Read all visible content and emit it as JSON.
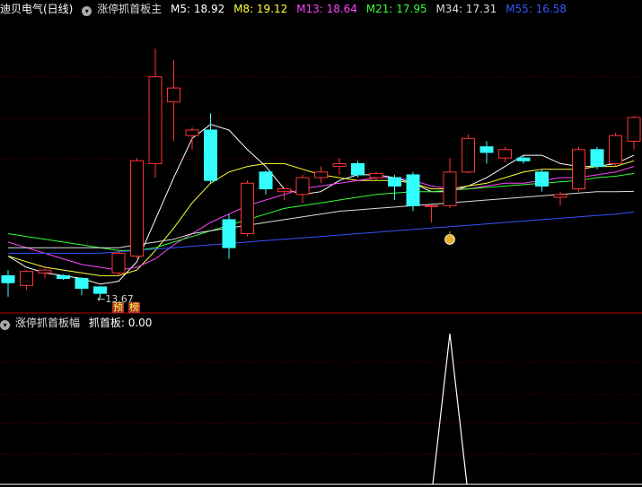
{
  "main_header": {
    "security_name": "迪贝电气(日线)",
    "indicator_name": "涨停抓首板主",
    "mas": [
      {
        "label": "M5: 18.92",
        "color": "#ffffff"
      },
      {
        "label": "M8: 19.12",
        "color": "#ffff33"
      },
      {
        "label": "M13: 18.64",
        "color": "#ff44ff"
      },
      {
        "label": "M21: 17.95",
        "color": "#33ff33"
      },
      {
        "label": "M34: 17.31",
        "color": "#dddddd"
      },
      {
        "label": "M55: 16.58",
        "color": "#3355ff"
      }
    ]
  },
  "sub_header": {
    "indicator_name": "涨停抓首板幅",
    "value_label": "抓首板: 0.00"
  },
  "low_price_label": "←13.67",
  "badges": [
    "预",
    "榜"
  ],
  "colors": {
    "up": "#ff3333",
    "down": "#33ffff",
    "grid": "#7a0000"
  },
  "chart_data": {
    "type": "candlestick",
    "price_range": [
      13.0,
      23.5
    ],
    "candles": [
      {
        "o": 14.3,
        "h": 14.5,
        "l": 13.55,
        "c": 14.05
      },
      {
        "o": 13.95,
        "h": 14.5,
        "l": 13.8,
        "c": 14.45
      },
      {
        "o": 14.4,
        "h": 14.55,
        "l": 14.2,
        "c": 14.5
      },
      {
        "o": 14.3,
        "h": 14.35,
        "l": 14.15,
        "c": 14.2
      },
      {
        "o": 14.2,
        "h": 14.25,
        "l": 13.6,
        "c": 13.85
      },
      {
        "o": 13.9,
        "h": 13.9,
        "l": 13.5,
        "c": 13.67
      },
      {
        "o": 14.4,
        "h": 15.2,
        "l": 14.3,
        "c": 15.1
      },
      {
        "o": 15.0,
        "h": 18.5,
        "l": 14.9,
        "c": 18.4
      },
      {
        "o": 18.3,
        "h": 22.4,
        "l": 17.8,
        "c": 21.4
      },
      {
        "o": 20.5,
        "h": 22.0,
        "l": 19.1,
        "c": 21.0
      },
      {
        "o": 19.3,
        "h": 19.6,
        "l": 18.8,
        "c": 19.5
      },
      {
        "o": 19.5,
        "h": 20.1,
        "l": 17.6,
        "c": 17.7
      },
      {
        "o": 16.3,
        "h": 16.5,
        "l": 14.9,
        "c": 15.3
      },
      {
        "o": 15.8,
        "h": 17.7,
        "l": 15.7,
        "c": 17.6
      },
      {
        "o": 18.0,
        "h": 18.05,
        "l": 17.2,
        "c": 17.4
      },
      {
        "o": 17.3,
        "h": 17.45,
        "l": 17.0,
        "c": 17.4
      },
      {
        "o": 17.2,
        "h": 17.9,
        "l": 16.9,
        "c": 17.8
      },
      {
        "o": 17.8,
        "h": 18.2,
        "l": 17.6,
        "c": 18.0
      },
      {
        "o": 18.2,
        "h": 18.5,
        "l": 17.9,
        "c": 18.3
      },
      {
        "o": 18.3,
        "h": 18.4,
        "l": 17.8,
        "c": 17.9
      },
      {
        "o": 17.8,
        "h": 18.0,
        "l": 17.7,
        "c": 17.95
      },
      {
        "o": 17.8,
        "h": 17.9,
        "l": 17.0,
        "c": 17.5
      },
      {
        "o": 17.9,
        "h": 18.0,
        "l": 16.6,
        "c": 16.8
      },
      {
        "o": 16.8,
        "h": 16.85,
        "l": 16.2,
        "c": 16.8
      },
      {
        "o": 16.8,
        "h": 18.5,
        "l": 16.7,
        "c": 18.0
      },
      {
        "o": 18.0,
        "h": 19.35,
        "l": 17.95,
        "c": 19.2
      },
      {
        "o": 18.9,
        "h": 19.1,
        "l": 18.3,
        "c": 18.7
      },
      {
        "o": 18.5,
        "h": 18.9,
        "l": 18.35,
        "c": 18.8
      },
      {
        "o": 18.5,
        "h": 18.6,
        "l": 18.3,
        "c": 18.4
      },
      {
        "o": 18.0,
        "h": 18.1,
        "l": 17.3,
        "c": 17.5
      },
      {
        "o": 17.1,
        "h": 17.3,
        "l": 16.8,
        "c": 17.2
      },
      {
        "o": 17.4,
        "h": 18.9,
        "l": 17.3,
        "c": 18.8
      },
      {
        "o": 18.8,
        "h": 18.9,
        "l": 18.1,
        "c": 18.2
      },
      {
        "o": 18.3,
        "h": 19.4,
        "l": 18.2,
        "c": 19.3
      },
      {
        "o": 19.1,
        "h": 20.0,
        "l": 18.8,
        "c": 19.95
      }
    ],
    "ma_lines": [
      {
        "name": "M5",
        "color": "#ffffff",
        "values": [
          15.0,
          14.6,
          14.4,
          14.3,
          14.2,
          14.0,
          14.1,
          14.8,
          16.3,
          17.8,
          19.2,
          19.7,
          19.5,
          18.8,
          18.2,
          17.4,
          17.2,
          17.3,
          17.7,
          17.9,
          17.9,
          17.8,
          17.6,
          17.3,
          17.3,
          17.5,
          17.8,
          18.2,
          18.6,
          18.6,
          18.3,
          18.2,
          18.2,
          18.3,
          18.6
        ]
      },
      {
        "name": "M8",
        "color": "#ffff33",
        "values": [
          15.0,
          14.8,
          14.6,
          14.5,
          14.4,
          14.3,
          14.3,
          14.5,
          15.2,
          16.0,
          16.9,
          17.6,
          18.0,
          18.2,
          18.3,
          18.3,
          18.1,
          17.9,
          17.8,
          17.7,
          17.7,
          17.7,
          17.6,
          17.4,
          17.4,
          17.5,
          17.6,
          17.8,
          18.0,
          18.1,
          18.1,
          18.1,
          18.2,
          18.2,
          18.4
        ]
      },
      {
        "name": "M13",
        "color": "#ff44ff",
        "values": [
          15.5,
          15.3,
          15.1,
          14.9,
          14.7,
          14.6,
          14.5,
          14.6,
          14.9,
          15.4,
          15.8,
          16.2,
          16.5,
          16.8,
          17.0,
          17.2,
          17.4,
          17.5,
          17.6,
          17.7,
          17.8,
          17.8,
          17.7,
          17.5,
          17.4,
          17.4,
          17.5,
          17.6,
          17.6,
          17.7,
          17.8,
          17.8,
          17.9,
          18.0,
          18.2
        ]
      },
      {
        "name": "M21",
        "color": "#33ff33",
        "values": [
          15.8,
          15.7,
          15.6,
          15.5,
          15.4,
          15.3,
          15.2,
          15.2,
          15.3,
          15.5,
          15.7,
          15.9,
          16.1,
          16.3,
          16.5,
          16.7,
          16.8,
          16.9,
          17.0,
          17.1,
          17.2,
          17.25,
          17.3,
          17.3,
          17.35,
          17.4,
          17.45,
          17.5,
          17.55,
          17.6,
          17.65,
          17.7,
          17.8,
          17.85,
          17.95
        ]
      },
      {
        "name": "M34",
        "color": "#dddddd",
        "values": [
          15.3,
          15.3,
          15.3,
          15.3,
          15.3,
          15.3,
          15.3,
          15.4,
          15.5,
          15.6,
          15.8,
          15.9,
          16.0,
          16.1,
          16.2,
          16.3,
          16.4,
          16.5,
          16.6,
          16.65,
          16.7,
          16.75,
          16.8,
          16.85,
          16.9,
          16.95,
          17.0,
          17.05,
          17.1,
          17.15,
          17.2,
          17.25,
          17.3,
          17.3,
          17.31
        ]
      },
      {
        "name": "M55",
        "color": "#3355ff",
        "values": [
          15.1,
          15.1,
          15.1,
          15.1,
          15.1,
          15.1,
          15.15,
          15.2,
          15.25,
          15.3,
          15.35,
          15.4,
          15.45,
          15.5,
          15.55,
          15.6,
          15.65,
          15.7,
          15.75,
          15.8,
          15.85,
          15.9,
          15.95,
          16.0,
          16.05,
          16.1,
          16.15,
          16.2,
          16.25,
          16.3,
          16.35,
          16.4,
          16.45,
          16.5,
          16.58
        ]
      }
    ],
    "signal": {
      "index": 24,
      "value": 1.0
    }
  }
}
